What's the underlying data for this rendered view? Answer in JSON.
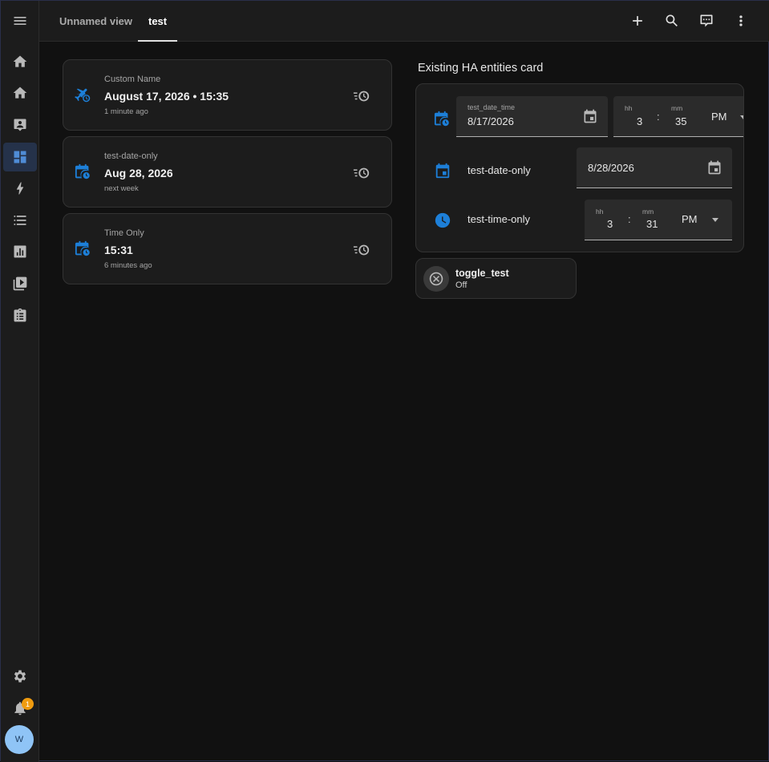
{
  "header": {
    "tabs": [
      {
        "label": "Unnamed view"
      },
      {
        "label": "test"
      }
    ]
  },
  "sidebar": {
    "items": [
      {
        "icon": "menu-icon"
      },
      {
        "icon": "home-icon"
      },
      {
        "icon": "home-icon"
      },
      {
        "icon": "badge-account-icon"
      },
      {
        "icon": "dashboard-icon"
      },
      {
        "icon": "energy-bolt-icon"
      },
      {
        "icon": "list-icon"
      },
      {
        "icon": "chart-box-icon"
      },
      {
        "icon": "media-play-icon"
      },
      {
        "icon": "clipboard-list-icon"
      }
    ],
    "settings_icon": "gear-icon",
    "notifications": {
      "icon": "bell-icon",
      "count": "1"
    },
    "avatar_initial": "W"
  },
  "cards": [
    {
      "label": "Custom Name",
      "value": "August 17, 2026 • 15:35",
      "relative": "1 minute ago",
      "icon": "airplane-clock-icon"
    },
    {
      "label": "test-date-only",
      "value": "Aug 28, 2026",
      "relative": "next week",
      "icon": "calendar-clock-icon"
    },
    {
      "label": "Time Only",
      "value": "15:31",
      "relative": "6 minutes ago",
      "icon": "calendar-clock-icon"
    }
  ],
  "entities_card": {
    "title": "Existing HA entities card",
    "datetime_row": {
      "field_label": "test_date_time",
      "date": "8/17/2026",
      "hh_label": "hh",
      "mm_label": "mm",
      "hour": "3",
      "minute": "35",
      "ampm": "PM",
      "sep": ":"
    },
    "date_row": {
      "name": "test-date-only",
      "date": "8/28/2026"
    },
    "time_row": {
      "name": "test-time-only",
      "hh_label": "hh",
      "mm_label": "mm",
      "hour": "3",
      "minute": "31",
      "ampm": "PM",
      "sep": ":"
    }
  },
  "toggle": {
    "name": "toggle_test",
    "state": "Off"
  },
  "colors": {
    "accent": "#1d7fd8",
    "background": "#111111",
    "card": "#1c1c1c",
    "badge": "#ef9b0f"
  }
}
